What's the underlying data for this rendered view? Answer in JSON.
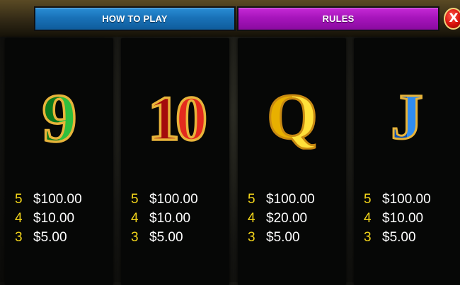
{
  "tabs": {
    "how_to_play": "HOW TO PLAY",
    "rules": "RULES"
  },
  "close_button": {
    "label": "X",
    "icon": "close-icon"
  },
  "colors": {
    "how_to_play_tab": "#1972b8",
    "rules_tab": "#a715bc",
    "close_button": "#d8120c",
    "count_text": "#f3d51a",
    "amount_text": "#ffffff",
    "panel_background": "#060706"
  },
  "paytable": [
    {
      "symbol": "9",
      "icon": "nine-symbol-icon",
      "color": "#1b9a2a",
      "rows": [
        {
          "count": "5",
          "amount": "$100.00"
        },
        {
          "count": "4",
          "amount": "$10.00"
        },
        {
          "count": "3",
          "amount": "$5.00"
        }
      ]
    },
    {
      "symbol": "10",
      "icon": "ten-symbol-icon",
      "color": "#d01818",
      "rows": [
        {
          "count": "5",
          "amount": "$100.00"
        },
        {
          "count": "4",
          "amount": "$10.00"
        },
        {
          "count": "3",
          "amount": "$5.00"
        }
      ]
    },
    {
      "symbol": "Q",
      "icon": "queen-symbol-icon",
      "color": "#f2c10c",
      "rows": [
        {
          "count": "5",
          "amount": "$100.00"
        },
        {
          "count": "4",
          "amount": "$20.00"
        },
        {
          "count": "3",
          "amount": "$5.00"
        }
      ]
    },
    {
      "symbol": "J",
      "icon": "jack-symbol-icon",
      "color": "#1a6ad6",
      "rows": [
        {
          "count": "5",
          "amount": "$100.00"
        },
        {
          "count": "4",
          "amount": "$10.00"
        },
        {
          "count": "3",
          "amount": "$5.00"
        }
      ]
    }
  ]
}
